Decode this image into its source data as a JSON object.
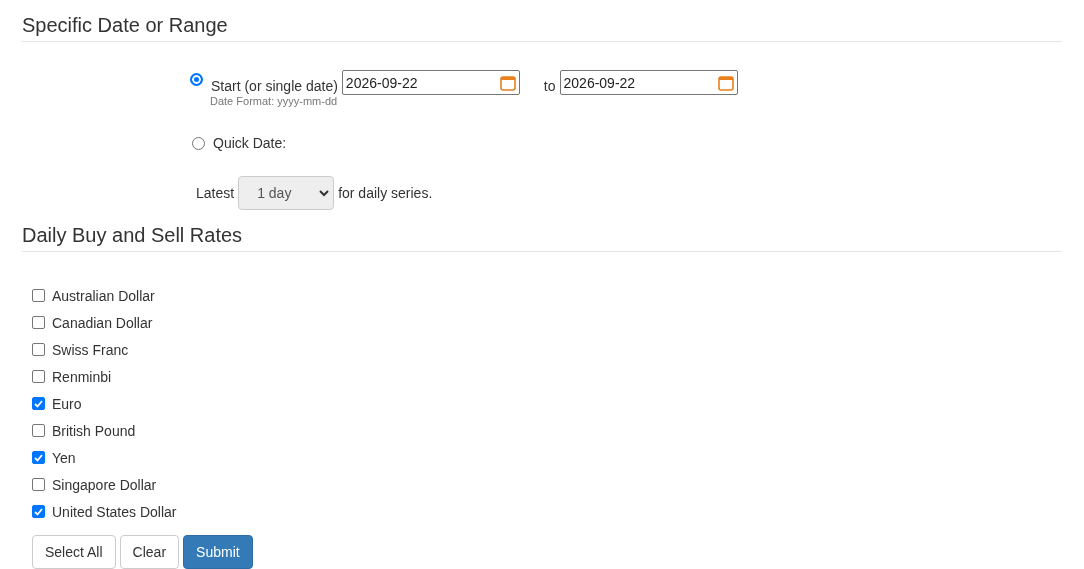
{
  "date_section": {
    "title": "Specific Date or Range",
    "options": [
      {
        "kind": "range",
        "selected": true,
        "label": "Start (or single date)",
        "start": "2026-09-22",
        "to_label": "to",
        "end": "2026-09-22",
        "hint": "Date Format: yyyy-mm-dd"
      },
      {
        "kind": "quick",
        "selected": false,
        "label": "Quick Date:"
      }
    ],
    "latest": {
      "prefix": "Latest",
      "value": "1 day",
      "suffix": "for daily series."
    }
  },
  "rates_section": {
    "title": "Daily Buy and Sell Rates",
    "currencies": [
      {
        "label": "Australian Dollar",
        "checked": false
      },
      {
        "label": "Canadian Dollar",
        "checked": false
      },
      {
        "label": "Swiss Franc",
        "checked": false
      },
      {
        "label": "Renminbi",
        "checked": false
      },
      {
        "label": "Euro",
        "checked": true
      },
      {
        "label": "British Pound",
        "checked": false
      },
      {
        "label": "Yen",
        "checked": true
      },
      {
        "label": "Singapore Dollar",
        "checked": false
      },
      {
        "label": "United States Dollar",
        "checked": true
      }
    ],
    "buttons": [
      {
        "label": "Select All",
        "kind": "default"
      },
      {
        "label": "Clear",
        "kind": "default"
      },
      {
        "label": "Submit",
        "kind": "primary"
      }
    ]
  }
}
